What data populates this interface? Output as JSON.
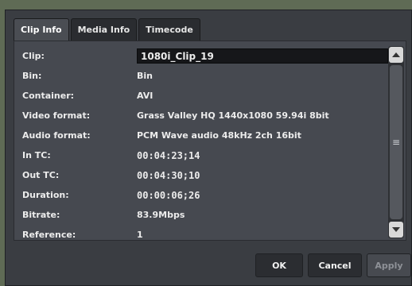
{
  "tabs": [
    {
      "label": "Clip Info",
      "active": true
    },
    {
      "label": "Media Info",
      "active": false
    },
    {
      "label": "Timecode",
      "active": false
    }
  ],
  "rows": [
    {
      "label": "Clip:",
      "value": "1080i_Clip_19"
    },
    {
      "label": "Bin:",
      "value": "Bin"
    },
    {
      "label": "Container:",
      "value": "AVI"
    },
    {
      "label": "Video format:",
      "value": "Grass Valley HQ 1440x1080 59.94i 8bit"
    },
    {
      "label": "Audio format:",
      "value": "PCM Wave audio 48kHz 2ch 16bit"
    },
    {
      "label": "In TC:",
      "value": "00:04:23;14"
    },
    {
      "label": "Out TC:",
      "value": "00:04:30;10"
    },
    {
      "label": "Duration:",
      "value": "00:00:06;26"
    },
    {
      "label": "Bitrate:",
      "value": "83.9Mbps"
    },
    {
      "label": "Reference:",
      "value": "1"
    }
  ],
  "buttons": {
    "ok": "OK",
    "cancel": "Cancel",
    "apply": "Apply"
  },
  "icons": {
    "scroll_up": "chevron-up-icon",
    "scroll_down": "chevron-down-icon",
    "thumb_grip": "grip-icon"
  }
}
